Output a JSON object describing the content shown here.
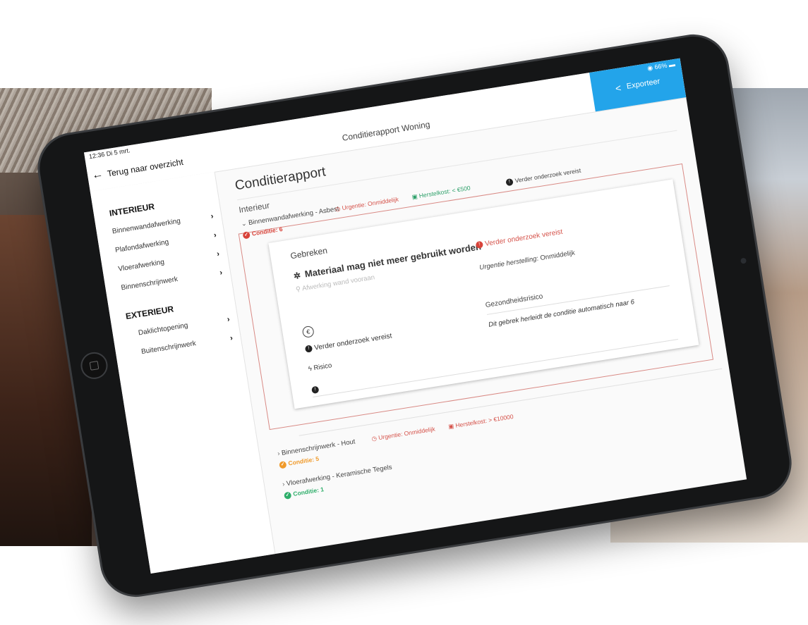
{
  "status": {
    "time": "12:36",
    "date": "Di 5 mrt.",
    "battery": "66%"
  },
  "topbar": {
    "title": "Conditierapport Woning",
    "export_label": "Exporteer"
  },
  "sidebar": {
    "back_label": "Terug naar overzicht",
    "interior_heading": "INTERIEUR",
    "interior_items": [
      "Binnenwandafwerking",
      "Plafondafwerking",
      "Vloerafwerking",
      "Binnenschrijnwerk"
    ],
    "exterior_heading": "EXTERIEUR",
    "exterior_items": [
      "Daklichtopening",
      "Buitenschrijnwerk"
    ]
  },
  "main": {
    "title": "Conditierapport",
    "section": "Interieur",
    "items": [
      {
        "name": "Binnenwandafwerking - Asbest",
        "urgency": "Urgentie: Onmiddelijk",
        "cost": "Herstelkost: < €500",
        "extra": "Verder onderzoek vereist",
        "condition": "Conditie: 6",
        "expanded": true
      },
      {
        "name": "Binnenschrijnwerk - Hout",
        "urgency": "Urgentie: Onmiddelijk",
        "cost": "Herstelkost: > €10000",
        "condition": "Conditie: 5",
        "expanded": false
      },
      {
        "name": "Vloerafwerking - Keramische Tegels",
        "condition": "Conditie: 1",
        "expanded": false
      }
    ],
    "defects": {
      "heading": "Gebreken",
      "title": "Materiaal mag niet meer gebruikt worden",
      "location": "Afwerking wand vooraan",
      "further_research": "Verder onderzoek vereist",
      "urgency_label": "Urgentie herstelling",
      "urgency_value": ": Onmiddelijk",
      "further_research_left": "Verder onderzoek vereist",
      "risk": "Risico",
      "health_risk": "Gezondheidsrisico",
      "note": "Dit gebrek herleidt de conditie automatisch naar 6"
    }
  },
  "colors": {
    "accent": "#23a4ea",
    "danger": "#d8433a",
    "warning": "#f09a2a",
    "success": "#2eae6a"
  }
}
